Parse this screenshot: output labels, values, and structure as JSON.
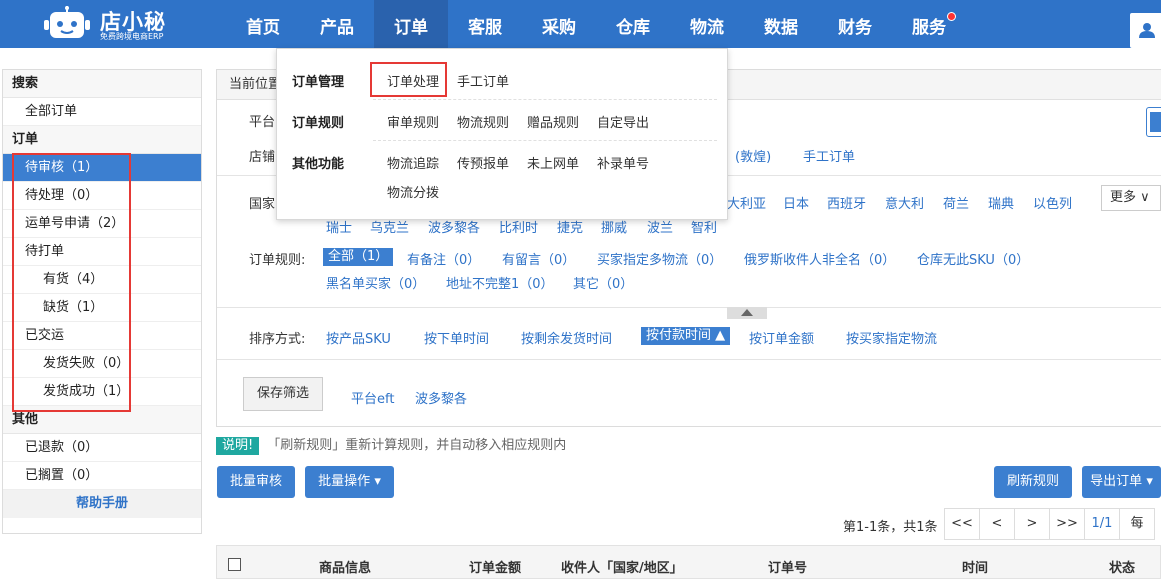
{
  "brand": {
    "name": "店小秘",
    "tagline": "免费跨境电商ERP"
  },
  "nav": [
    {
      "label": "首页"
    },
    {
      "label": "产品"
    },
    {
      "label": "订单"
    },
    {
      "label": "客服"
    },
    {
      "label": "采购"
    },
    {
      "label": "仓库"
    },
    {
      "label": "物流"
    },
    {
      "label": "数据"
    },
    {
      "label": "财务"
    },
    {
      "label": "服务"
    }
  ],
  "dropdown": {
    "order_mgmt": {
      "title": "订单管理",
      "items": [
        "订单处理",
        "手工订单"
      ]
    },
    "order_rules": {
      "title": "订单规则",
      "items": [
        "审单规则",
        "物流规则",
        "赠品规则",
        "自定导出"
      ]
    },
    "other": {
      "title": "其他功能",
      "items": [
        "物流追踪",
        "传预报单",
        "未上网单",
        "补录单号",
        "物流分拨"
      ]
    }
  },
  "sidebar": {
    "search_title": "搜索",
    "all_orders": "全部订单",
    "order_title": "订单",
    "items": [
      {
        "label": "待审核",
        "count": "（1）"
      },
      {
        "label": "待处理",
        "count": "（0）"
      },
      {
        "label": "运单号申请",
        "count": "（2）"
      }
    ],
    "to_print": "待打单",
    "to_print_items": [
      {
        "label": "有货",
        "count": "（4）"
      },
      {
        "label": "缺货",
        "count": "（1）"
      }
    ],
    "shipped": "已交运",
    "shipped_items": [
      {
        "label": "发货失败",
        "count": "（0）"
      },
      {
        "label": "发货成功",
        "count": "（1）"
      }
    ],
    "other_title": "其他",
    "other_items": [
      {
        "label": "已退款",
        "count": "（0）"
      },
      {
        "label": "已搁置",
        "count": "（0）"
      }
    ],
    "help": "帮助手册"
  },
  "panel": {
    "crumb": "当前位置",
    "platform_label": "平台",
    "shop_label": "店铺",
    "shop_links": [
      "(敦煌)",
      "手工订单"
    ],
    "country_label": "国家",
    "countries_row1": [
      "大利亚",
      "日本",
      "西班牙",
      "意大利",
      "荷兰",
      "瑞典",
      "以色列"
    ],
    "countries_row2": [
      "瑞士",
      "乌克兰",
      "波多黎各",
      "比利时",
      "捷克",
      "挪威",
      "波兰",
      "智利"
    ],
    "more": "更多",
    "rules_label": "订单规则:",
    "rules_active": "全部（1）",
    "rules_row1": [
      "有备注（0）",
      "有留言（0）",
      "买家指定多物流（0）",
      "俄罗斯收件人非全名（0）",
      "仓库无此SKU（0）"
    ],
    "rules_row2": [
      "黑名单买家（0）",
      "地址不完整1（0）",
      "其它（0）"
    ],
    "sort_label": "排序方式:",
    "sort_items": [
      "按产品SKU",
      "按下单时间",
      "按剩余发货时间"
    ],
    "sort_active": "按付款时间",
    "sort_items2": [
      "按订单金额",
      "按买家指定物流"
    ],
    "save_filter": "保存筛选",
    "saved_filters": [
      "平台eft",
      "波多黎各"
    ]
  },
  "notice": {
    "label": "说明!",
    "text": "「刷新规则」重新计算规则，并自动移入相应规则内"
  },
  "actions": {
    "batch_review": "批量审核",
    "batch_ops": "批量操作",
    "refresh_rules": "刷新规则",
    "export_orders": "导出订单"
  },
  "pager": {
    "summary": "第1-1条，共1条",
    "first": "<<",
    "prev": "<",
    "next": ">",
    "last": ">>",
    "page": "1/1",
    "per": "每"
  },
  "table_headers": [
    "商品信息",
    "订单金额",
    "收件人「国家/地区」",
    "订单号",
    "时间",
    "状态"
  ],
  "colors": {
    "brand_blue": "#2f73c8",
    "highlight_red": "#e53935",
    "notice_teal": "#1fa8a0"
  }
}
